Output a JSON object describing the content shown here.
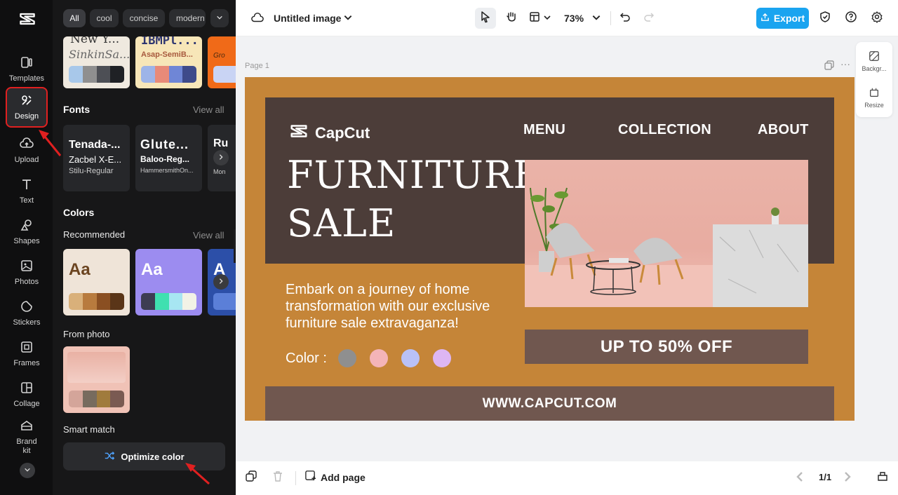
{
  "rail": {
    "items": [
      {
        "label": "Templates",
        "icon": "templates-icon"
      },
      {
        "label": "Design",
        "icon": "design-icon",
        "active": true
      },
      {
        "label": "Upload",
        "icon": "upload-cloud-icon"
      },
      {
        "label": "Text",
        "icon": "text-icon"
      },
      {
        "label": "Shapes",
        "icon": "shapes-icon"
      },
      {
        "label": "Photos",
        "icon": "photos-icon"
      },
      {
        "label": "Stickers",
        "icon": "stickers-icon"
      },
      {
        "label": "Frames",
        "icon": "frames-icon"
      },
      {
        "label": "Collage",
        "icon": "collage-icon"
      },
      {
        "label": "Brand kit",
        "icon": "brand-kit-icon"
      }
    ]
  },
  "panel": {
    "chips": [
      "All",
      "cool",
      "concise",
      "modern"
    ],
    "top_cards": [
      {
        "line1": "New Y...",
        "line2": "SinkinSa...",
        "swatches": [
          "#a8c8ea",
          "#8f8f8f",
          "#4d4f55",
          "#1f2125"
        ]
      },
      {
        "line1": "IBMPl...",
        "line2": "Asap-SemiB...",
        "swatches": [
          "#9db4e8",
          "#e88a78",
          "#6f86d6",
          "#3e4a8a"
        ]
      },
      {
        "line1": "Gro",
        "swatches": [
          "#c9d4f4"
        ]
      }
    ],
    "fonts_title": "Fonts",
    "fonts_view_all": "View all",
    "font_cards": [
      {
        "l1": "Tenada-...",
        "l2": "Zacbel X-E...",
        "l3": "Stilu-Regular"
      },
      {
        "l1": "Glute...",
        "l2": "Baloo-Reg...",
        "l3": "HammersmithOn..."
      },
      {
        "l1": "Ru",
        "l3": "Mon"
      }
    ],
    "colors_title": "Colors",
    "recommended_title": "Recommended",
    "recommended_view_all": "View all",
    "color_cards": [
      {
        "text": "Aa",
        "bg": "#efe4d8",
        "fg": "#6b4420",
        "swatches": [
          "#d9b07a",
          "#b87b3e",
          "#8a4f22",
          "#5a3518"
        ]
      },
      {
        "text": "Aa",
        "bg": "#9c8cf0",
        "fg": "#ffffff",
        "swatches": [
          "#3d3d52",
          "#3fe0b0",
          "#a7e6f2",
          "#f2f2e6"
        ]
      },
      {
        "text": "A",
        "bg": "#2c4fa8",
        "fg": "#ffffff",
        "swatches": [
          "#5b7fd8"
        ]
      }
    ],
    "from_photo_title": "From photo",
    "photo_swatches": [
      "#d4a59a",
      "#776b5e",
      "#a07b3c",
      "#7a5a52"
    ],
    "smart_match_title": "Smart match",
    "optimize_label": "Optimize color"
  },
  "topbar": {
    "title": "Untitled image",
    "zoom": "73%",
    "export_label": "Export"
  },
  "canvas": {
    "page_label": "Page 1",
    "side_tools": [
      {
        "label": "Backgr..."
      },
      {
        "label": "Resize"
      }
    ]
  },
  "design": {
    "brand": "CapCut",
    "nav": [
      "MENU",
      "COLLECTION",
      "ABOUT"
    ],
    "headline_1": "FURNITURE",
    "headline_2": "SALE",
    "description_lines": [
      "Embark on a journey of home",
      "transformation with our exclusive",
      "furniture sale extravaganza!"
    ],
    "color_label": "Color :",
    "color_dots": [
      "#8f8f8f",
      "#f4b4b8",
      "#b9c1f7",
      "#ddb6f3"
    ],
    "promo": "UP TO 50% OFF",
    "website": "WWW.CAPCUT.COM",
    "colors": {
      "background": "#c58538",
      "header": "#4c3d39",
      "band": "#70574f"
    }
  },
  "bottombar": {
    "add_page_label": "Add page",
    "page_counter": "1/1"
  }
}
